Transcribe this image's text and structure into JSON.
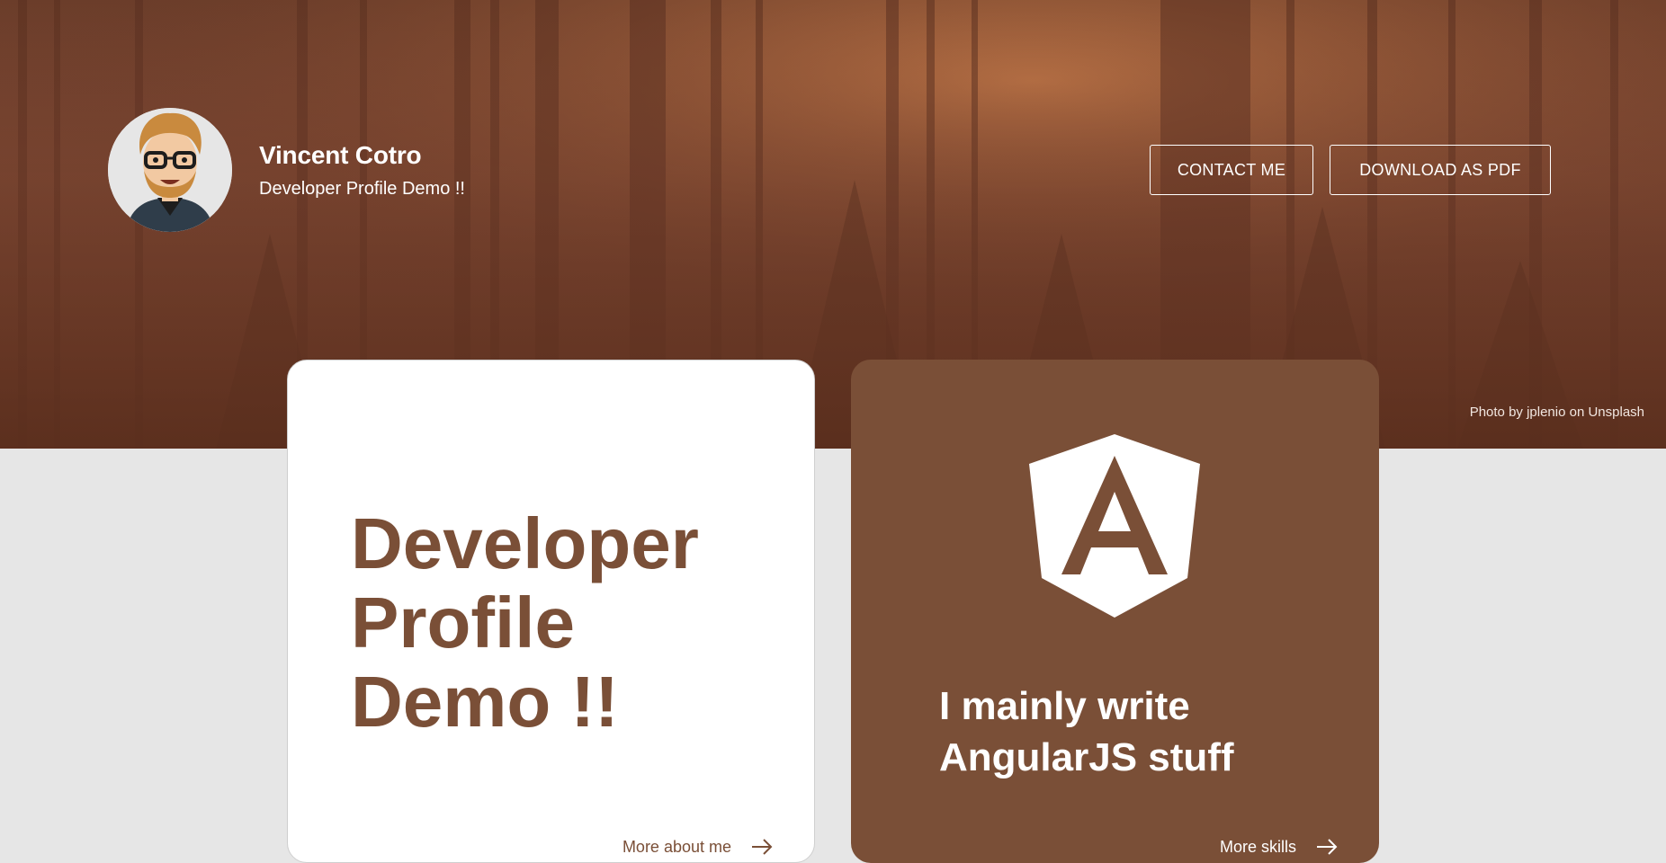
{
  "header": {
    "name": "Vincent Cotro",
    "tagline": "Developer Profile Demo !!",
    "contact_label": "CONTACT ME",
    "download_label": "DOWNLOAD AS PDF",
    "photo_credit": "Photo by jplenio on Unsplash"
  },
  "intro_card": {
    "title": "Developer Profile Demo !!",
    "link_label": "More about me",
    "link_icon": "arrow-right-icon"
  },
  "skills_card": {
    "icon": "angular-logo",
    "text": "I mainly write AngularJS stuff",
    "link_label": "More skills",
    "link_icon": "arrow-right-icon"
  },
  "colors": {
    "brand_brown": "#7a4f37",
    "page_background": "#e6e6e6",
    "card_white": "#ffffff"
  }
}
